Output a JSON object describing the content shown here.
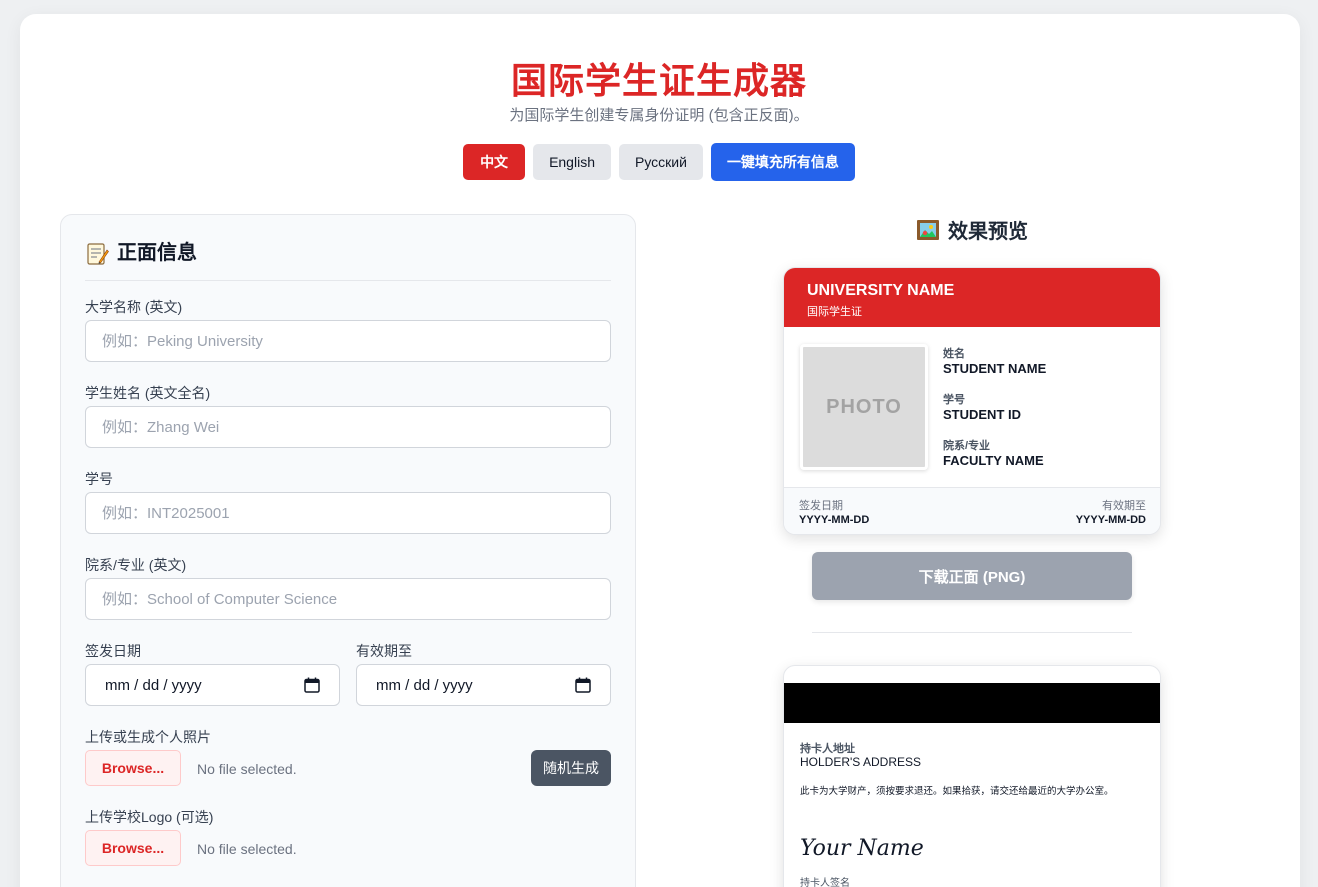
{
  "header": {
    "title": "国际学生证生成器",
    "subtitle": "为国际学生创建专属身份证明 (包含正反面)。"
  },
  "toolbar": {
    "languages": [
      {
        "label": "中文",
        "active": true
      },
      {
        "label": "English",
        "active": false
      },
      {
        "label": "Русский",
        "active": false
      }
    ],
    "autofill_label": "一键填充所有信息"
  },
  "form": {
    "heading": "正面信息",
    "university": {
      "label": "大学名称 (英文)",
      "placeholder": "例如：Peking University"
    },
    "student_name": {
      "label": "学生姓名 (英文全名)",
      "placeholder": "例如：Zhang Wei"
    },
    "student_id": {
      "label": "学号",
      "placeholder": "例如：INT2025001"
    },
    "faculty": {
      "label": "院系/专业 (英文)",
      "placeholder": "例如：School of Computer Science"
    },
    "issue_date": {
      "label": "签发日期",
      "value": "mm / dd / yyyy"
    },
    "expiry_date": {
      "label": "有效期至",
      "value": "mm / dd / yyyy"
    },
    "photo": {
      "label": "上传或生成个人照片",
      "browse": "Browse...",
      "status": "No file selected.",
      "random": "随机生成"
    },
    "logo": {
      "label": "上传学校Logo (可选)",
      "browse": "Browse...",
      "status": "No file selected."
    }
  },
  "preview": {
    "heading": "效果预览",
    "front": {
      "university": "UNIVERSITY NAME",
      "card_type": "国际学生证",
      "photo_placeholder": "PHOTO",
      "name_label": "姓名",
      "name_value": "STUDENT NAME",
      "id_label": "学号",
      "id_value": "STUDENT ID",
      "faculty_label": "院系/专业",
      "faculty_value": "FACULTY NAME",
      "issue_label": "签发日期",
      "issue_value": "YYYY-MM-DD",
      "expiry_label": "有效期至",
      "expiry_value": "YYYY-MM-DD"
    },
    "download_front": "下载正面 (PNG)",
    "back": {
      "address_label": "持卡人地址",
      "address_value": "HOLDER'S ADDRESS",
      "note": "此卡为大学财产，须按要求退还。如果拾获，请交还给最近的大学办公室。",
      "signature": "Your Name",
      "signature_label": "持卡人签名"
    }
  },
  "colors": {
    "brand_red": "#dc2626",
    "autofill_blue": "#2563eb",
    "disabled_gray": "#9ca3af"
  }
}
